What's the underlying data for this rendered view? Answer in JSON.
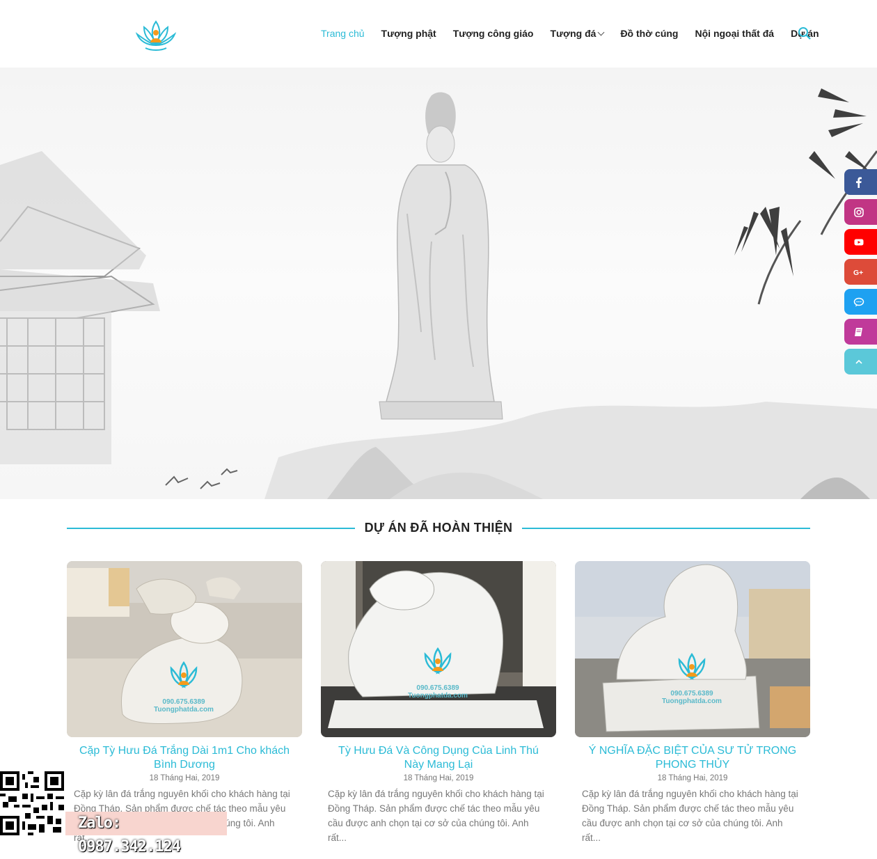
{
  "nav": {
    "items": [
      {
        "label": "Trang chủ",
        "active": true
      },
      {
        "label": "Tượng phật",
        "active": false
      },
      {
        "label": "Tượng công giáo",
        "active": false
      },
      {
        "label": "Tượng đá",
        "active": false,
        "dropdown": true
      },
      {
        "label": "Đồ thờ cúng",
        "active": false
      },
      {
        "label": "Nội ngoại thất đá",
        "active": false
      },
      {
        "label": "Dự án",
        "active": false
      }
    ],
    "search_icon": "search-icon"
  },
  "social": [
    "facebook-icon",
    "instagram-icon",
    "youtube-icon",
    "google-plus-icon",
    "chat-icon",
    "book-icon",
    "scroll-top-icon"
  ],
  "section": {
    "title": "DỰ ÁN ĐÃ HOÀN THIỆN"
  },
  "posts": [
    {
      "title": "Cặp Tỳ Hưu Đá Trắng Dài 1m1 Cho khách Bình Dương",
      "date": "18 Tháng Hai, 2019",
      "excerpt": "Cặp kỳ lân đá trắng nguyên khối cho khách hàng tại Đồng Tháp. Sản phẩm được chế tác theo mẫu yêu cầu được anh chọn tại cơ sở của chúng tôi. Anh rất..."
    },
    {
      "title": "Tỳ Hưu Đá Và Công Dụng Của Linh Thú Này Mang Lại",
      "date": "18 Tháng Hai, 2019",
      "excerpt": "Cặp kỳ lân đá trắng nguyên khối cho khách hàng tại Đồng Tháp. Sản phẩm được chế tác theo mẫu yêu cầu được anh chọn tại cơ sở của chúng tôi. Anh rất..."
    },
    {
      "title": "Ý NGHĨA ĐẶC BIỆT CỦA SƯ TỬ TRONG PHONG THỦY",
      "date": "18 Tháng Hai, 2019",
      "excerpt": "Cặp kỳ lân đá trắng nguyên khối cho khách hàng tại Đồng Tháp. Sản phẩm được chế tác theo mẫu yêu cầu được anh chọn tại cơ sở của chúng tôi. Anh rất..."
    }
  ],
  "watermark": {
    "phone": "090.675.6389",
    "site": "Tuongphatda.com"
  },
  "zalo": {
    "label": "Zalo: 0987.342.124"
  },
  "colors": {
    "accent": "#2bbbd6",
    "facebook": "#3b5998",
    "instagram": "#c13584",
    "youtube": "#ff0000",
    "google": "#dd4b39",
    "chat": "#1ea1f1",
    "book": "#c03a9a",
    "top": "#5bc8d9"
  }
}
